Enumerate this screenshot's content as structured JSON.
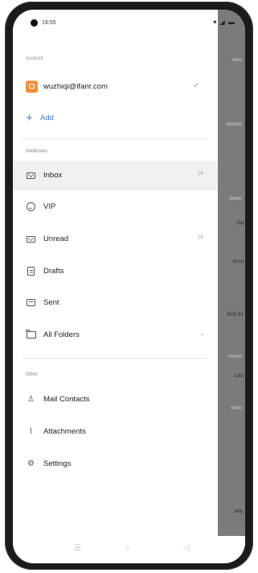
{
  "status_bar": {
    "time": "19:55",
    "icons": "▾ ◢ ▬"
  },
  "sections": {
    "account": "Account",
    "mailboxes": "Mailboxes",
    "other": "Other"
  },
  "account": {
    "email": "wuzhiqi@ifanr.com",
    "check": "✓"
  },
  "add": {
    "plus": "+",
    "label": "Add"
  },
  "mailboxes": [
    {
      "label": "Inbox",
      "count": "18",
      "icon": "mail-icon"
    },
    {
      "label": "VIP",
      "count": "",
      "icon": "vip-icon"
    },
    {
      "label": "Unread",
      "count": "18",
      "icon": "unread-mail-icon"
    },
    {
      "label": "Drafts",
      "count": "",
      "icon": "drafts-icon"
    },
    {
      "label": "Sent",
      "count": "",
      "icon": "sent-icon"
    },
    {
      "label": "All Folders",
      "count": "",
      "icon": "folder-icon"
    }
  ],
  "other_items": [
    {
      "label": "Mail Contacts",
      "glyph": "♙",
      "icon": "contacts-icon"
    },
    {
      "label": "Attachments",
      "glyph": "⌇",
      "icon": "attachment-icon"
    },
    {
      "label": "Settings",
      "glyph": "⚙",
      "icon": "settings-icon"
    }
  ],
  "background_snippets": [
    "...",
    "ing",
    "ernal",
    "RVE 61",
    "2.63",
    "ially."
  ],
  "nav_bar": {
    "menu": "☰",
    "home": "○",
    "back": "◁"
  },
  "colors": {
    "accent": "#3a7fd0",
    "avatar": "#f1913a"
  }
}
